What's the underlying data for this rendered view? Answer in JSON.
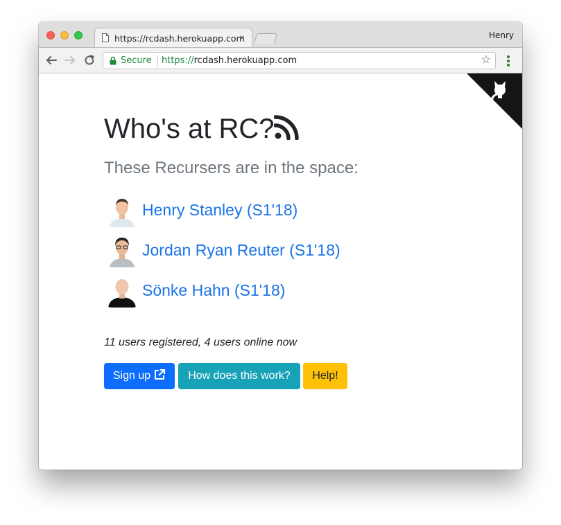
{
  "browser": {
    "tab_title": "https://rcdash.herokuapp.com",
    "tab_close": "×",
    "profile_name": "Henry",
    "secure_label": "Secure",
    "url_scheme": "https://",
    "url_host": "rcdash.herokuapp.com",
    "bookmark_icon": "star-icon"
  },
  "page": {
    "title": "Who's at RC?",
    "subtitle": "These Recursers are in the space:",
    "users": [
      {
        "name": "Henry Stanley (S1'18)"
      },
      {
        "name": "Jordan Ryan Reuter (S1'18)"
      },
      {
        "name": "Sönke Hahn (S1'18)"
      }
    ],
    "stats": "11 users registered, 4 users online now",
    "buttons": {
      "signup": "Sign up",
      "how": "How does this work?",
      "help": "Help!"
    }
  },
  "colors": {
    "link": "#1a73e8",
    "primary": "#0d6efd",
    "info": "#17a2b8",
    "warning": "#ffc107",
    "secure": "#1a8a3a"
  }
}
